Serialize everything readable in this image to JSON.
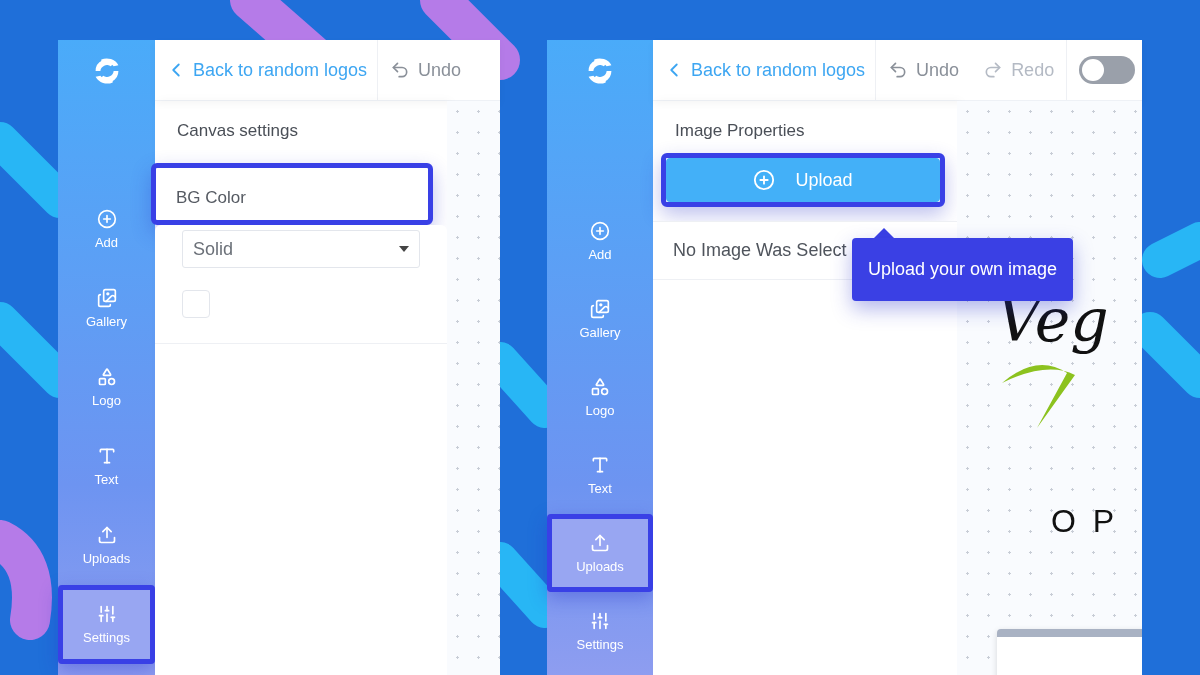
{
  "panels": [
    {
      "sidebar": {
        "items": [
          {
            "label": "Add",
            "kind": "add",
            "selected": false
          },
          {
            "label": "Gallery",
            "kind": "gallery",
            "selected": false
          },
          {
            "label": "Logo",
            "kind": "logo",
            "selected": false
          },
          {
            "label": "Text",
            "kind": "text",
            "selected": false
          },
          {
            "label": "Uploads",
            "kind": "uploads",
            "selected": false
          },
          {
            "label": "Settings",
            "kind": "settings",
            "selected": true
          }
        ]
      },
      "toolbar": {
        "back": "Back to random logos",
        "actions": [
          {
            "label": "Undo",
            "kind": "undo",
            "disabled": false
          }
        ]
      },
      "properties": {
        "title": "Canvas settings",
        "controls": [
          {
            "kind": "field-label",
            "label": "BG Color",
            "highlighted": true
          },
          {
            "kind": "select",
            "label": "Solid",
            "highlighted": false
          },
          {
            "kind": "swatch",
            "highlighted": false
          }
        ]
      }
    },
    {
      "sidebar": {
        "items": [
          {
            "label": "Add",
            "kind": "add",
            "selected": false
          },
          {
            "label": "Gallery",
            "kind": "gallery",
            "selected": false
          },
          {
            "label": "Logo",
            "kind": "logo",
            "selected": false
          },
          {
            "label": "Text",
            "kind": "text",
            "selected": false
          },
          {
            "label": "Uploads",
            "kind": "uploads",
            "selected": true
          },
          {
            "label": "Settings",
            "kind": "settings",
            "selected": false
          }
        ]
      },
      "toolbar": {
        "back": "Back to random logos",
        "actions": [
          {
            "label": "Undo",
            "kind": "undo",
            "disabled": false
          },
          {
            "label": "Redo",
            "kind": "redo",
            "disabled": true
          }
        ],
        "toggle": {
          "on": false
        }
      },
      "properties": {
        "title": "Image Properties",
        "controls": [
          {
            "kind": "upload-button",
            "label": "Upload",
            "highlighted": true
          },
          {
            "kind": "note",
            "label": "No Image Was Select",
            "highlighted": false
          }
        ]
      },
      "tooltip": "Upload your own image",
      "canvas": {
        "logo_texts": [
          "Veg",
          "O P"
        ]
      }
    }
  ]
}
